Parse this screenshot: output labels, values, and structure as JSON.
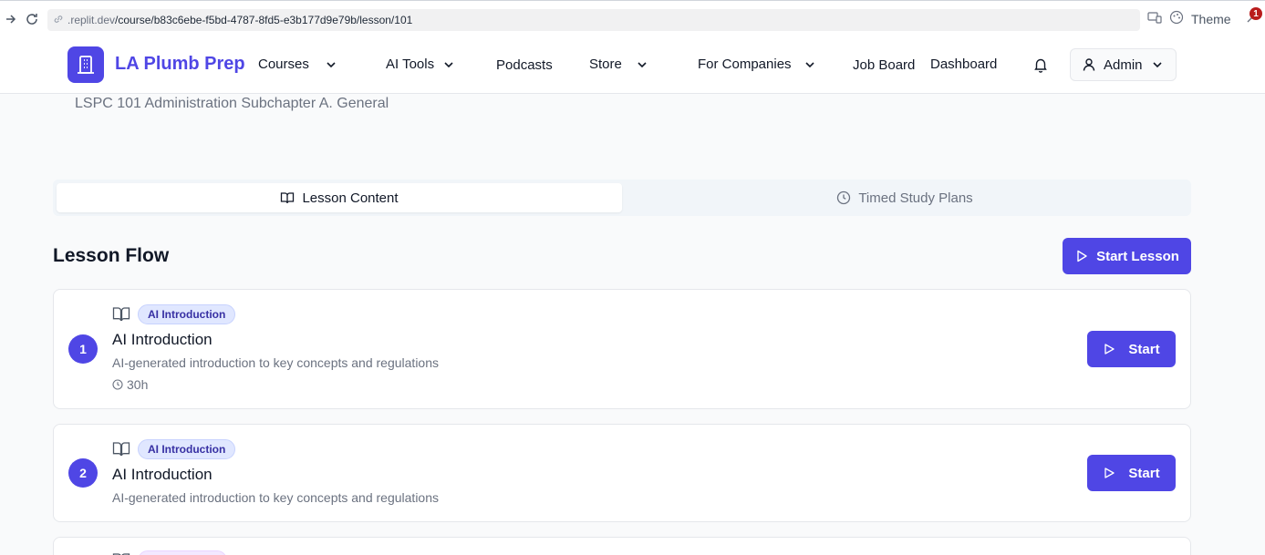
{
  "browser": {
    "url_domain": ".replit.dev",
    "url_path": "/course/b83c6ebe-f5bd-4787-8fd5-e3b177d9e79b/lesson/101",
    "theme_label": "Theme",
    "notification_count": "1"
  },
  "header": {
    "brand": "LA Plumb Prep",
    "nav": {
      "courses": "Courses",
      "ai_tools": "AI Tools",
      "podcasts": "Podcasts",
      "store": "Store",
      "for_companies": "For Companies",
      "job_board": "Job Board",
      "dashboard": "Dashboard"
    },
    "user_label": "Admin"
  },
  "page": {
    "subtitle": "LSPC 101 Administration Subchapter A. General",
    "tabs": {
      "lesson_content": "Lesson Content",
      "timed_study_plans": "Timed Study Plans"
    },
    "flow_title": "Lesson Flow",
    "start_lesson_label": "Start Lesson"
  },
  "lessons": [
    {
      "number": "1",
      "tag": "AI Introduction",
      "title": "AI Introduction",
      "description": "AI-generated introduction to key concepts and regulations",
      "duration": "30h",
      "button": "Start"
    },
    {
      "number": "2",
      "tag": "AI Introduction",
      "title": "AI Introduction",
      "description": "AI-generated introduction to key concepts and regulations",
      "button": "Start"
    }
  ],
  "colors": {
    "primary": "#4f46e5",
    "tag_bg": "#e0e7ff",
    "tag_text": "#3730a3"
  }
}
